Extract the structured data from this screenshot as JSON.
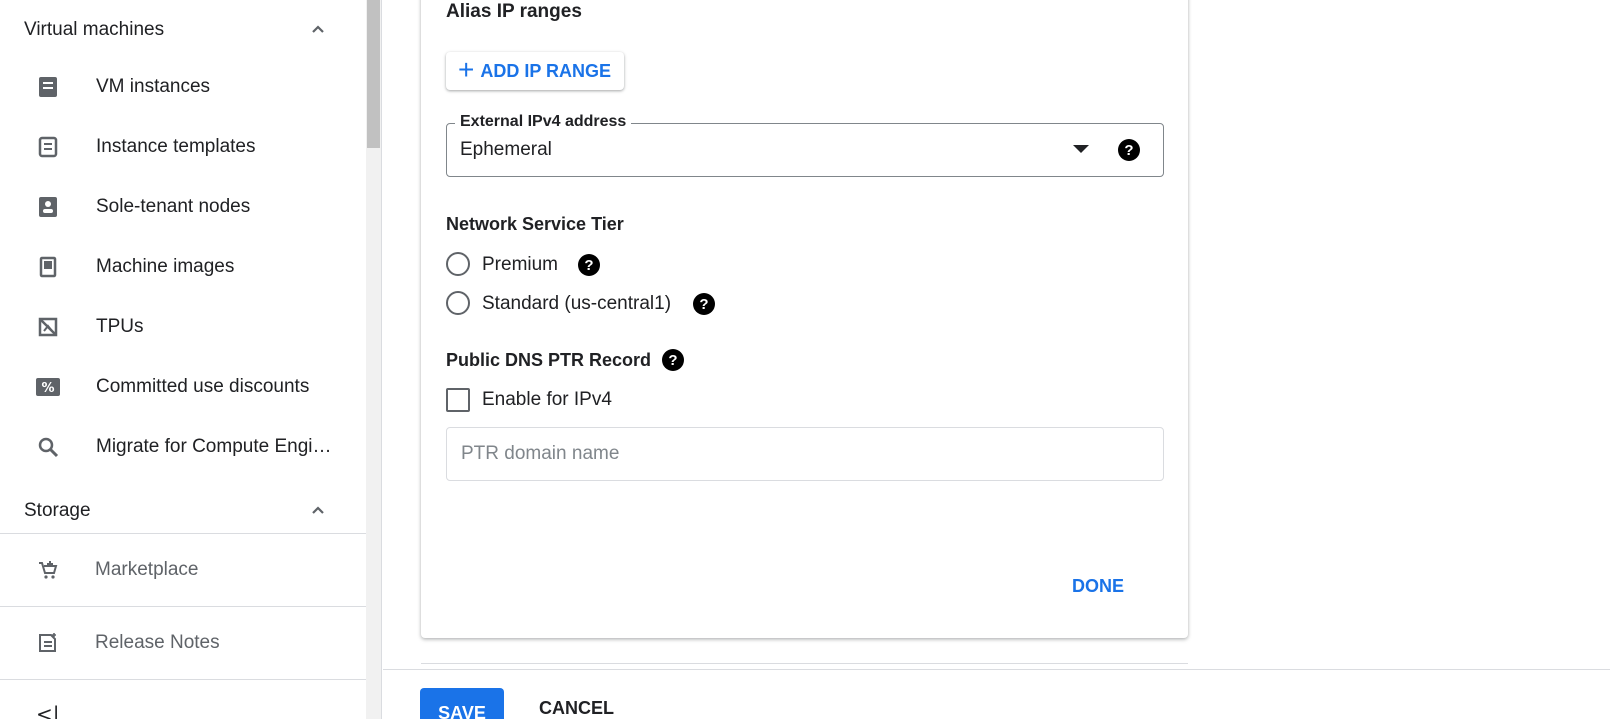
{
  "sidebar": {
    "sections": [
      {
        "title": "Virtual machines"
      },
      {
        "title": "Storage"
      }
    ],
    "vm_items": [
      {
        "label": "VM instances",
        "icon": "vm-instances-icon"
      },
      {
        "label": "Instance templates",
        "icon": "instance-templates-icon"
      },
      {
        "label": "Sole-tenant nodes",
        "icon": "sole-tenant-nodes-icon"
      },
      {
        "label": "Machine images",
        "icon": "machine-images-icon"
      },
      {
        "label": "TPUs",
        "icon": "tpu-icon"
      },
      {
        "label": "Committed use discounts",
        "icon": "percent-icon"
      },
      {
        "label": "Migrate for Compute Engi…",
        "icon": "search-icon"
      }
    ],
    "footer": [
      {
        "label": "Marketplace",
        "icon": "cart-icon"
      },
      {
        "label": "Release Notes",
        "icon": "release-notes-icon"
      }
    ],
    "collapse_glyph": "<|"
  },
  "main": {
    "alias_title": "Alias IP ranges",
    "add_ip_label": "ADD IP RANGE",
    "external_ipv4": {
      "label": "External IPv4 address",
      "value": "Ephemeral"
    },
    "network_tier": {
      "title": "Network Service Tier",
      "options": [
        {
          "label": "Premium",
          "selected": false
        },
        {
          "label": "Standard (us-central1)",
          "selected": false
        }
      ]
    },
    "dns": {
      "title": "Public DNS PTR Record",
      "checkbox_label": "Enable for IPv4",
      "checked": false,
      "placeholder": "PTR domain name"
    },
    "done_label": "DONE"
  },
  "footer_bar": {
    "save_label": "SAVE",
    "cancel_label": "CANCEL"
  },
  "colors": {
    "accent": "#1a73e8",
    "text": "#202124",
    "muted": "#5f6368",
    "border": "#dadce0"
  }
}
